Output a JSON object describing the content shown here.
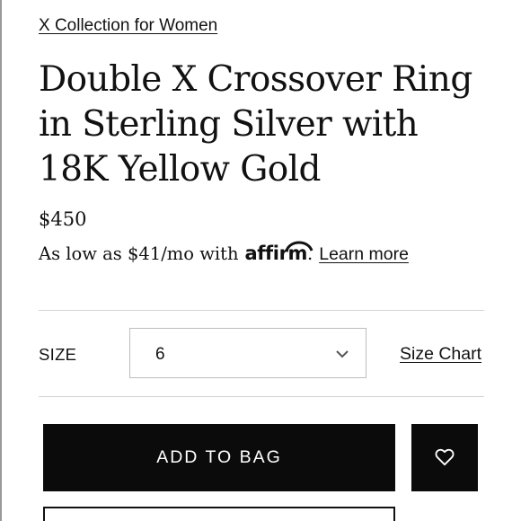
{
  "breadcrumb": {
    "collection_link": "X Collection for Women"
  },
  "product": {
    "title": "Double X Crossover Ring in Sterling Silver with 18K Yellow Gold",
    "price": "$450"
  },
  "financing": {
    "text": "As low as $41/mo with",
    "brand": "affirm",
    "period": ".",
    "learn_more": "Learn more"
  },
  "size": {
    "label": "SIZE",
    "selected": "6",
    "chart_link": "Size Chart"
  },
  "actions": {
    "add_to_bag": "ADD TO BAG",
    "wishlist_icon": "heart-icon"
  }
}
